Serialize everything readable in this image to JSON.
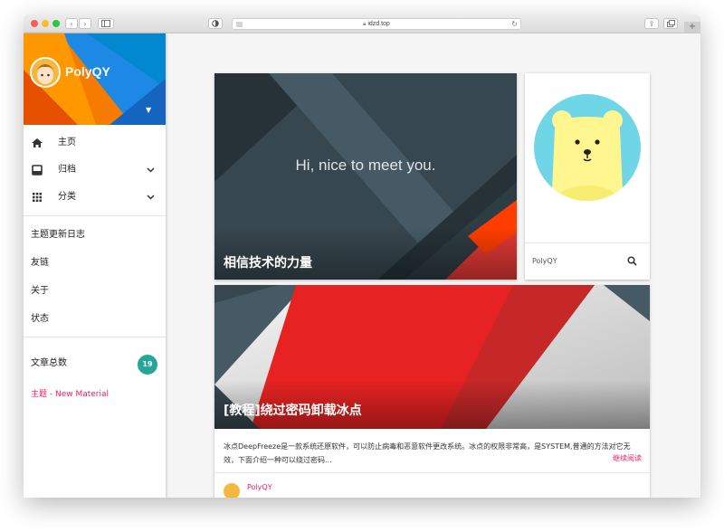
{
  "browser": {
    "url": "idzd.top",
    "traffic_colors": [
      "#fd5f57",
      "#fdbb2d",
      "#2ac840"
    ],
    "back_icon": "chevron-left-icon",
    "forward_icon": "chevron-right-icon"
  },
  "sidebar": {
    "brand": "PolyQY",
    "nav": [
      {
        "label": "主页",
        "icon": "home-icon",
        "expandable": false
      },
      {
        "label": "归档",
        "icon": "archive-icon",
        "expandable": true
      },
      {
        "label": "分类",
        "icon": "grid-icon",
        "expandable": true
      }
    ],
    "links": [
      "主题更新日志",
      "友链",
      "关于",
      "状态"
    ],
    "post_count_label": "文章总数",
    "post_count": "19",
    "theme_label": "主题 - New Material"
  },
  "hero": {
    "greeting": "Hi, nice to meet you.",
    "title": "相信技术的力量"
  },
  "profile": {
    "name": "PolyQY",
    "search_icon": "search-icon"
  },
  "post": {
    "title": "[教程]绕过密码卸载冰点",
    "excerpt": "冰点DeepFreeze是一款系统还原软件，可以防止病毒和恶意软件更改系统。冰点的权限非常高，是SYSTEM,普通的方法对它无效，下面介绍一种可以绕过密码...",
    "read_more": "继续阅读",
    "author": "PolyQY"
  },
  "colors": {
    "accent": "#e91e63",
    "badge": "#26a69a",
    "hero_bg": "#37474f",
    "red": "#f44336"
  }
}
